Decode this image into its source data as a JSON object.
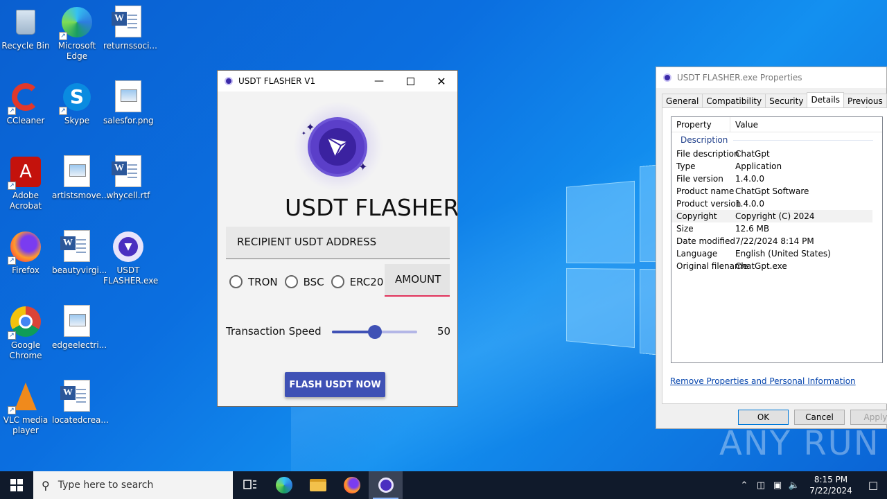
{
  "desktop": {
    "icons": [
      {
        "label": "Recycle Bin"
      },
      {
        "label": "Microsoft Edge"
      },
      {
        "label": "returnssoci..."
      },
      {
        "label": "CCleaner"
      },
      {
        "label": "Skype"
      },
      {
        "label": "salesfor.png"
      },
      {
        "label": "Adobe Acrobat"
      },
      {
        "label": "artistsmove..."
      },
      {
        "label": "whycell.rtf"
      },
      {
        "label": "Firefox"
      },
      {
        "label": "beautyvirgi..."
      },
      {
        "label": "USDT FLASHER.exe"
      },
      {
        "label": "Google Chrome"
      },
      {
        "label": "edgeelectri..."
      },
      {
        "label": "VLC media player"
      },
      {
        "label": "locatedcrea..."
      }
    ]
  },
  "app": {
    "title": "USDT FLASHER V1",
    "heading": "USDT FLASHER",
    "address_placeholder": "RECIPIENT USDT ADDRESS",
    "networks": [
      {
        "label": "TRON",
        "selected": false
      },
      {
        "label": "BSC",
        "selected": false
      },
      {
        "label": "ERC20",
        "selected": false
      }
    ],
    "amount_placeholder": "AMOUNT",
    "speed_label": "Transaction Speed",
    "speed_value": "50",
    "speed_fraction": 0.5,
    "button_label": "FLASH USDT NOW",
    "accent_color": "#3f51b5"
  },
  "properties": {
    "title": "USDT FLASHER.exe Properties",
    "tabs": [
      "General",
      "Compatibility",
      "Security",
      "Details",
      "Previous Versions"
    ],
    "active_tab": "Details",
    "col_property": "Property",
    "col_value": "Value",
    "group": "Description",
    "rows": [
      {
        "k": "File description",
        "v": "ChatGpt"
      },
      {
        "k": "Type",
        "v": "Application"
      },
      {
        "k": "File version",
        "v": "1.4.0.0"
      },
      {
        "k": "Product name",
        "v": "ChatGpt Software"
      },
      {
        "k": "Product version",
        "v": "1.4.0.0"
      },
      {
        "k": "Copyright",
        "v": "Copyright (C) 2024"
      },
      {
        "k": "Size",
        "v": "12.6 MB"
      },
      {
        "k": "Date modified",
        "v": "7/22/2024 8:14 PM"
      },
      {
        "k": "Language",
        "v": "English (United States)"
      },
      {
        "k": "Original filename",
        "v": "ChatGpt.exe"
      }
    ],
    "remove_link": "Remove Properties and Personal Information",
    "ok": "OK",
    "cancel": "Cancel",
    "apply": "Apply"
  },
  "watermark": "ANY RUN",
  "taskbar": {
    "search_placeholder": "Type here to search",
    "time": "8:15 PM",
    "date": "7/22/2024"
  }
}
